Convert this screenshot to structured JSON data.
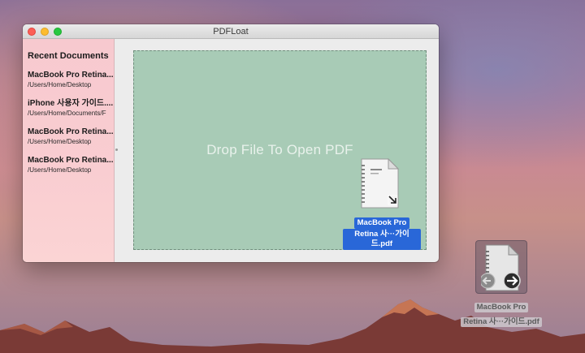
{
  "window": {
    "title": "PDFLoat"
  },
  "sidebar": {
    "title": "Recent Documents",
    "items": [
      {
        "name": "MacBook Pro Retina...",
        "path": "/Users/Home/Desktop"
      },
      {
        "name": "iPhone 사용자 가이드....",
        "path": "/Users/Home/Documents/F"
      },
      {
        "name": "MacBook Pro Retina...",
        "path": "/Users/Home/Desktop"
      },
      {
        "name": "MacBook Pro Retina...",
        "path": "/Users/Home/Desktop"
      }
    ]
  },
  "drop_zone": {
    "text": "Drop File To Open PDF"
  },
  "dragged_file": {
    "line1": "MacBook Pro",
    "line2": "Retina 사···가이드.pdf",
    "icon": "pdf-document-icon"
  },
  "desktop_file": {
    "line1": "MacBook Pro",
    "line2": "Retina 사···가이드.pdf",
    "icon": "pdf-document-icon"
  },
  "colors": {
    "drop_zone_bg": "#a8cbb6",
    "sidebar_bg": "#f9cdd1",
    "selection_blue": "#2967d8"
  }
}
